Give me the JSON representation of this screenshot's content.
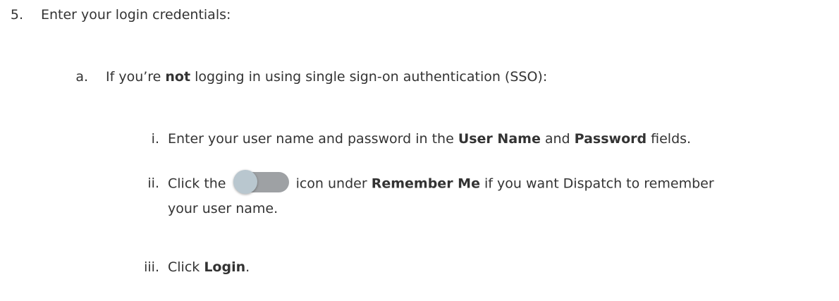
{
  "steps": {
    "step5": {
      "marker": "5.",
      "text": "Enter your login credentials:"
    },
    "step_a": {
      "marker": "a.",
      "text_before": "If you’re ",
      "bold": "not",
      "text_after": " logging in using single sign-on authentication (SSO):"
    },
    "step_i": {
      "marker": "i.",
      "text_before": "Enter your user name and password in the ",
      "bold1": "User Name",
      "text_middle": " and ",
      "bold2": "Password",
      "text_after": " fields."
    },
    "step_ii": {
      "marker": "ii.",
      "text_before": "Click the ",
      "icon": "toggle-switch-off-icon",
      "text_middle": " icon under ",
      "bold": "Remember Me",
      "text_after": " if you want Dispatch to remember",
      "text_line2": "your user name."
    },
    "step_iii": {
      "marker": "iii.",
      "text_before": "Click ",
      "bold": "Login",
      "text_after": "."
    }
  },
  "colors": {
    "text": "#333333",
    "toggle_track": "#9ea1a4",
    "toggle_knob": "#b9c7cf"
  }
}
